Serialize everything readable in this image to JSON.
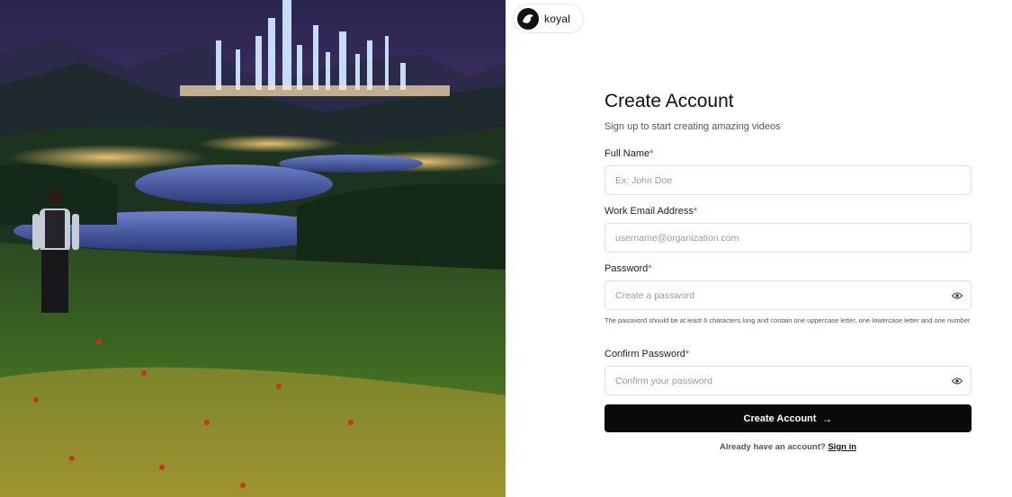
{
  "brand": {
    "name": "koyal",
    "logo_icon": "bird-icon"
  },
  "hero": {
    "icon": "landscape-illustration"
  },
  "form": {
    "title": "Create Account",
    "subtitle": "Sign up to start creating amazing videos",
    "required_mark": "*",
    "full_name": {
      "label": "Full Name",
      "placeholder": "Ex: John Doe"
    },
    "email": {
      "label": "Work Email Address",
      "placeholder": "username@organization.com"
    },
    "password": {
      "label": "Password",
      "placeholder": "Create a password",
      "hint": "The password should be at least 6 characters long and contain one uppercase letter, one lowercase letter and one number"
    },
    "confirm_password": {
      "label": "Confirm Password",
      "placeholder": "Confirm your password"
    },
    "submit_label": "Create Account",
    "submit_icon": "arrow-right-icon",
    "signin_prompt": "Already have an account?",
    "signin_link": "Sign in"
  },
  "colors": {
    "primary": "#0a0a0a",
    "required": "#e03131",
    "border": "#e1e1e1"
  }
}
